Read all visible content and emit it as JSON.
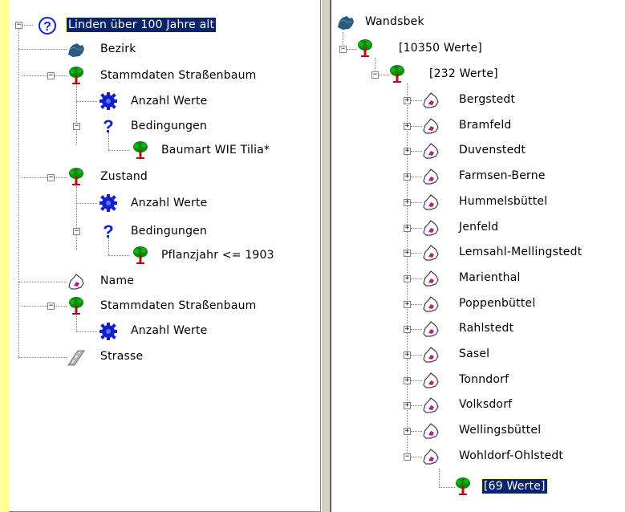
{
  "left_tree": {
    "root": "Linden über 100 Jahre alt",
    "bezirk": "Bezirk",
    "stammdaten_1": "Stammdaten Straßenbaum",
    "anzahl_1": "Anzahl Werte",
    "bedingungen_1": "Bedingungen",
    "baumart": "Baumart WIE Tilia*",
    "zustand": "Zustand",
    "anzahl_2": "Anzahl Werte",
    "bedingungen_2": "Bedingungen",
    "pflanzjahr": "Pflanzjahr <= 1903",
    "name": "Name",
    "stammdaten_2": "Stammdaten Straßenbaum",
    "anzahl_3": "Anzahl Werte",
    "strasse": "Strasse"
  },
  "right_tree": {
    "root": "Wandsbek",
    "werte_total": "[10350 Werte]",
    "werte_sub": "[232 Werte]",
    "districts": [
      "Bergstedt",
      "Bramfeld",
      "Duvenstedt",
      "Farmsen-Berne",
      "Hummelsbüttel",
      "Jenfeld",
      "Lemsahl-Mellingstedt",
      "Marienthal",
      "Poppenbüttel",
      "Rahlstedt",
      "Sasel",
      "Tonndorf",
      "Volksdorf",
      "Wellingsbüttel",
      "Wohldorf-Ohlstedt"
    ],
    "leaf": "[69 Werte]"
  },
  "colors": {
    "background": "#ffff99",
    "selection": "#0a246a"
  }
}
